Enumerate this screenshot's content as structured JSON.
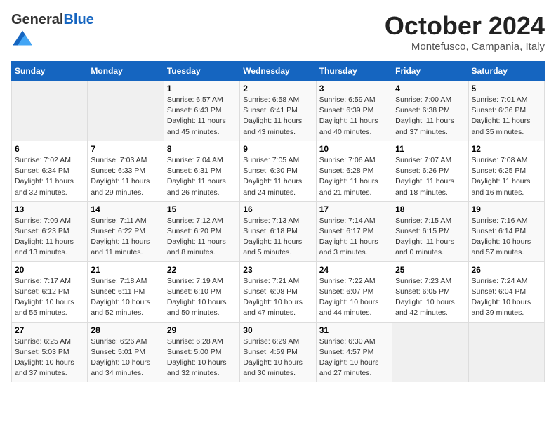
{
  "logo": {
    "general": "General",
    "blue": "Blue"
  },
  "header": {
    "month": "October 2024",
    "location": "Montefusco, Campania, Italy"
  },
  "weekdays": [
    "Sunday",
    "Monday",
    "Tuesday",
    "Wednesday",
    "Thursday",
    "Friday",
    "Saturday"
  ],
  "weeks": [
    [
      {
        "day": "",
        "empty": true
      },
      {
        "day": "",
        "empty": true
      },
      {
        "day": "1",
        "sunrise": "6:57 AM",
        "sunset": "6:43 PM",
        "daylight": "11 hours and 45 minutes."
      },
      {
        "day": "2",
        "sunrise": "6:58 AM",
        "sunset": "6:41 PM",
        "daylight": "11 hours and 43 minutes."
      },
      {
        "day": "3",
        "sunrise": "6:59 AM",
        "sunset": "6:39 PM",
        "daylight": "11 hours and 40 minutes."
      },
      {
        "day": "4",
        "sunrise": "7:00 AM",
        "sunset": "6:38 PM",
        "daylight": "11 hours and 37 minutes."
      },
      {
        "day": "5",
        "sunrise": "7:01 AM",
        "sunset": "6:36 PM",
        "daylight": "11 hours and 35 minutes."
      }
    ],
    [
      {
        "day": "6",
        "sunrise": "7:02 AM",
        "sunset": "6:34 PM",
        "daylight": "11 hours and 32 minutes."
      },
      {
        "day": "7",
        "sunrise": "7:03 AM",
        "sunset": "6:33 PM",
        "daylight": "11 hours and 29 minutes."
      },
      {
        "day": "8",
        "sunrise": "7:04 AM",
        "sunset": "6:31 PM",
        "daylight": "11 hours and 26 minutes."
      },
      {
        "day": "9",
        "sunrise": "7:05 AM",
        "sunset": "6:30 PM",
        "daylight": "11 hours and 24 minutes."
      },
      {
        "day": "10",
        "sunrise": "7:06 AM",
        "sunset": "6:28 PM",
        "daylight": "11 hours and 21 minutes."
      },
      {
        "day": "11",
        "sunrise": "7:07 AM",
        "sunset": "6:26 PM",
        "daylight": "11 hours and 18 minutes."
      },
      {
        "day": "12",
        "sunrise": "7:08 AM",
        "sunset": "6:25 PM",
        "daylight": "11 hours and 16 minutes."
      }
    ],
    [
      {
        "day": "13",
        "sunrise": "7:09 AM",
        "sunset": "6:23 PM",
        "daylight": "11 hours and 13 minutes."
      },
      {
        "day": "14",
        "sunrise": "7:11 AM",
        "sunset": "6:22 PM",
        "daylight": "11 hours and 11 minutes."
      },
      {
        "day": "15",
        "sunrise": "7:12 AM",
        "sunset": "6:20 PM",
        "daylight": "11 hours and 8 minutes."
      },
      {
        "day": "16",
        "sunrise": "7:13 AM",
        "sunset": "6:18 PM",
        "daylight": "11 hours and 5 minutes."
      },
      {
        "day": "17",
        "sunrise": "7:14 AM",
        "sunset": "6:17 PM",
        "daylight": "11 hours and 3 minutes."
      },
      {
        "day": "18",
        "sunrise": "7:15 AM",
        "sunset": "6:15 PM",
        "daylight": "11 hours and 0 minutes."
      },
      {
        "day": "19",
        "sunrise": "7:16 AM",
        "sunset": "6:14 PM",
        "daylight": "10 hours and 57 minutes."
      }
    ],
    [
      {
        "day": "20",
        "sunrise": "7:17 AM",
        "sunset": "6:12 PM",
        "daylight": "10 hours and 55 minutes."
      },
      {
        "day": "21",
        "sunrise": "7:18 AM",
        "sunset": "6:11 PM",
        "daylight": "10 hours and 52 minutes."
      },
      {
        "day": "22",
        "sunrise": "7:19 AM",
        "sunset": "6:10 PM",
        "daylight": "10 hours and 50 minutes."
      },
      {
        "day": "23",
        "sunrise": "7:21 AM",
        "sunset": "6:08 PM",
        "daylight": "10 hours and 47 minutes."
      },
      {
        "day": "24",
        "sunrise": "7:22 AM",
        "sunset": "6:07 PM",
        "daylight": "10 hours and 44 minutes."
      },
      {
        "day": "25",
        "sunrise": "7:23 AM",
        "sunset": "6:05 PM",
        "daylight": "10 hours and 42 minutes."
      },
      {
        "day": "26",
        "sunrise": "7:24 AM",
        "sunset": "6:04 PM",
        "daylight": "10 hours and 39 minutes."
      }
    ],
    [
      {
        "day": "27",
        "sunrise": "6:25 AM",
        "sunset": "5:03 PM",
        "daylight": "10 hours and 37 minutes."
      },
      {
        "day": "28",
        "sunrise": "6:26 AM",
        "sunset": "5:01 PM",
        "daylight": "10 hours and 34 minutes."
      },
      {
        "day": "29",
        "sunrise": "6:28 AM",
        "sunset": "5:00 PM",
        "daylight": "10 hours and 32 minutes."
      },
      {
        "day": "30",
        "sunrise": "6:29 AM",
        "sunset": "4:59 PM",
        "daylight": "10 hours and 30 minutes."
      },
      {
        "day": "31",
        "sunrise": "6:30 AM",
        "sunset": "4:57 PM",
        "daylight": "10 hours and 27 minutes."
      },
      {
        "day": "",
        "empty": true
      },
      {
        "day": "",
        "empty": true
      }
    ]
  ],
  "labels": {
    "sunrise": "Sunrise:",
    "sunset": "Sunset:",
    "daylight": "Daylight:"
  }
}
